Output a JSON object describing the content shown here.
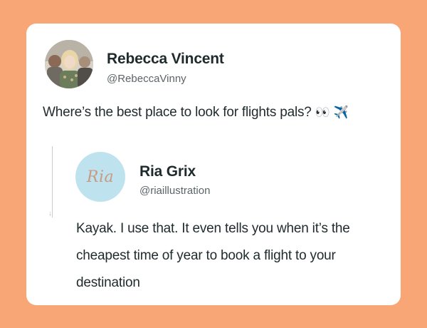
{
  "tweet": {
    "author_name": "Rebecca Vincent",
    "author_handle": "@RebeccaVinny",
    "text": "Where’s the best place to look for flights pals?",
    "emojis": "👀 ✈️"
  },
  "reply": {
    "author_name": "Ria Grix",
    "author_handle": "@riaillustration",
    "avatar_text": "Ria",
    "text": "Kayak. I use that. It even tells you when it’s the cheapest time of year to book a flight to your destination"
  },
  "colors": {
    "background": "#f9a676",
    "card": "#ffffff",
    "reply_avatar_bg": "#bfe3ee",
    "reply_avatar_text": "#c99a83"
  }
}
